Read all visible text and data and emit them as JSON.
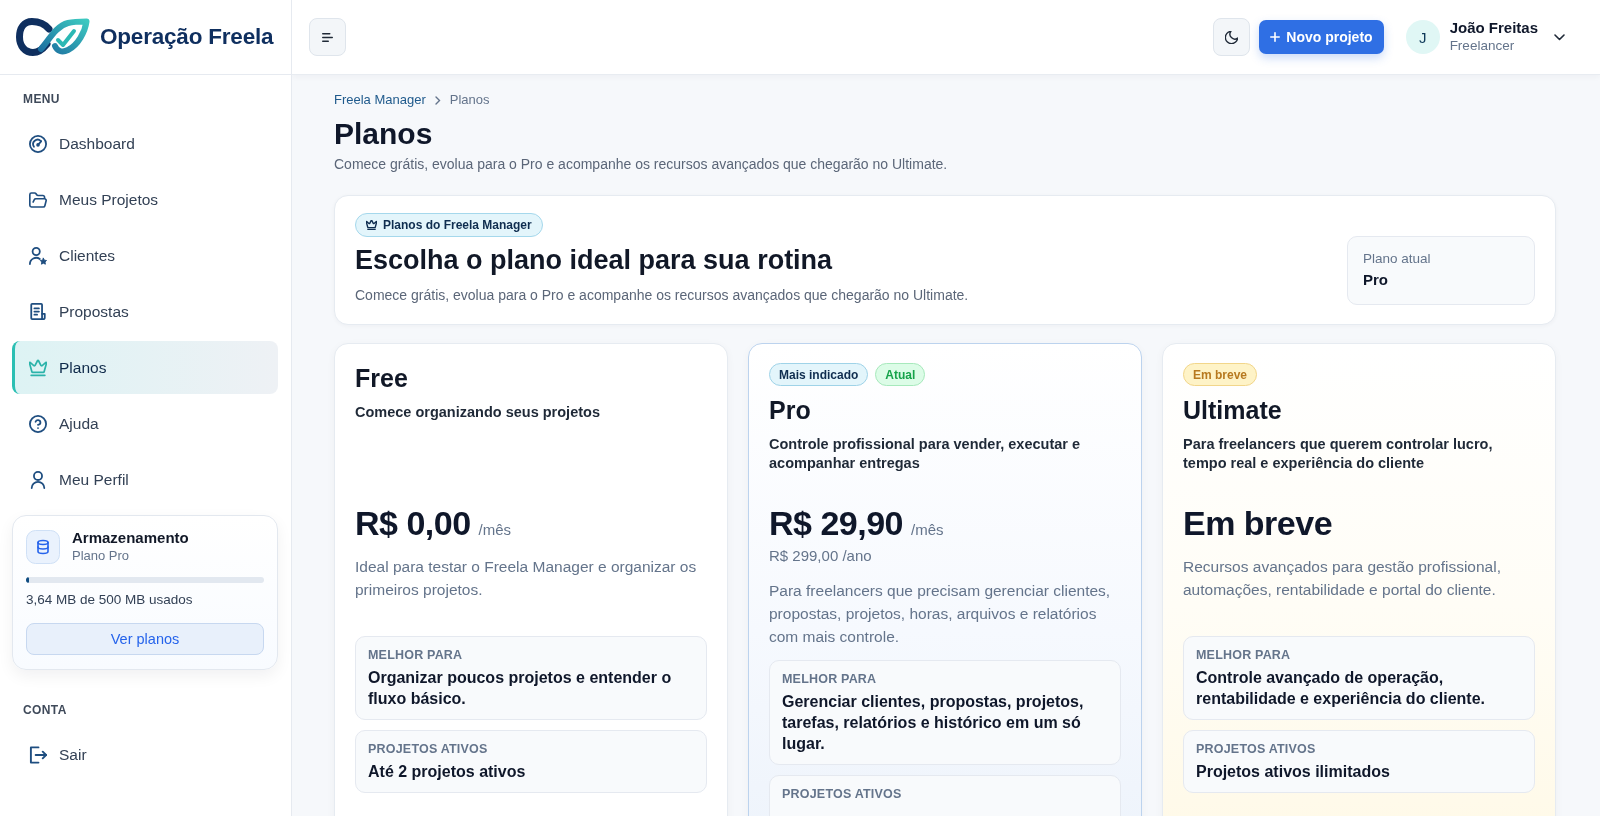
{
  "brand": {
    "name": "Operação Freela"
  },
  "topbar": {
    "new_project_button": "Novo projeto",
    "user": {
      "initial": "J",
      "name": "João Freitas",
      "role": "Freelancer"
    }
  },
  "sidebar": {
    "menu_title": "MENU",
    "menu": [
      {
        "label": "Dashboard",
        "selected": false
      },
      {
        "label": "Meus Projetos",
        "selected": false
      },
      {
        "label": "Clientes",
        "selected": false
      },
      {
        "label": "Propostas",
        "selected": false
      },
      {
        "label": "Planos",
        "selected": true
      },
      {
        "label": "Ajuda",
        "selected": false
      },
      {
        "label": "Meu Perfil",
        "selected": false
      }
    ],
    "storage": {
      "title": "Armazenamento",
      "plan": "Plano Pro",
      "level": 0.012,
      "usage": "3,64 MB de 500 MB usados",
      "button": "Ver planos"
    },
    "account_title": "CONTA",
    "account": [
      {
        "label": "Sair"
      }
    ]
  },
  "breadcrumb": [
    {
      "label": "Freela Manager"
    },
    {
      "label": "Planos"
    }
  ],
  "page": {
    "title": "Planos",
    "subtitle": "Comece grátis, evolua para o Pro e acompanhe os recursos avançados que chegarão no Ultimate."
  },
  "hero": {
    "badge": "Planos do Freela Manager",
    "title": "Escolha o plano ideal para sua rotina",
    "text": "Comece grátis, evolua para o Pro e acompanhe os recursos avançados que chegarão no Ultimate.",
    "current_plan": {
      "label": "Plano atual",
      "value": "Pro"
    }
  },
  "plans": [
    {
      "kind": "standard",
      "name": "Free",
      "tagline": "Comece organizando seus projetos",
      "price": "R$ 0,00",
      "period": "/mês",
      "description": "Ideal para testar o Freela Manager e organizar os primeiros projetos.",
      "features": [
        {
          "label": "MELHOR PARA",
          "value": "Organizar poucos projetos e entender o fluxo básico."
        },
        {
          "label": "PROJETOS ATIVOS",
          "value": "Até 2 projetos ativos"
        }
      ]
    },
    {
      "kind": "featured",
      "badges": [
        {
          "kind": "recommended",
          "label": "Mais indicado"
        },
        {
          "kind": "current",
          "label": "Atual"
        }
      ],
      "name": "Pro",
      "tagline": "Controle profissional para vender, executar e acompanhar entregas",
      "price": "R$ 29,90",
      "period": "/mês",
      "yearly": "R$ 299,00 /ano",
      "description": "Para freelancers que precisam gerenciar clientes, propostas, projetos, horas, arquivos e relatórios com mais controle.",
      "features": [
        {
          "label": "MELHOR PARA",
          "value": "Gerenciar clientes, propostas, projetos, tarefas, relatórios e histórico em um só lugar."
        },
        {
          "label": "PROJETOS ATIVOS"
        }
      ]
    },
    {
      "kind": "upcoming",
      "badges": [
        {
          "kind": "soon",
          "label": "Em breve"
        }
      ],
      "name": "Ultimate",
      "tagline": "Para freelancers que querem controlar lucro, tempo real e experiência do cliente",
      "price": "Em breve",
      "description": "Recursos avançados para gestão profissional, automações, rentabilidade e portal do cliente.",
      "features": [
        {
          "label": "MELHOR PARA",
          "value": "Controle avançado de operação, rentabilidade e experiência do cliente."
        },
        {
          "label": "PROJETOS ATIVOS",
          "value": "Projetos ativos ilimitados"
        }
      ]
    }
  ]
}
